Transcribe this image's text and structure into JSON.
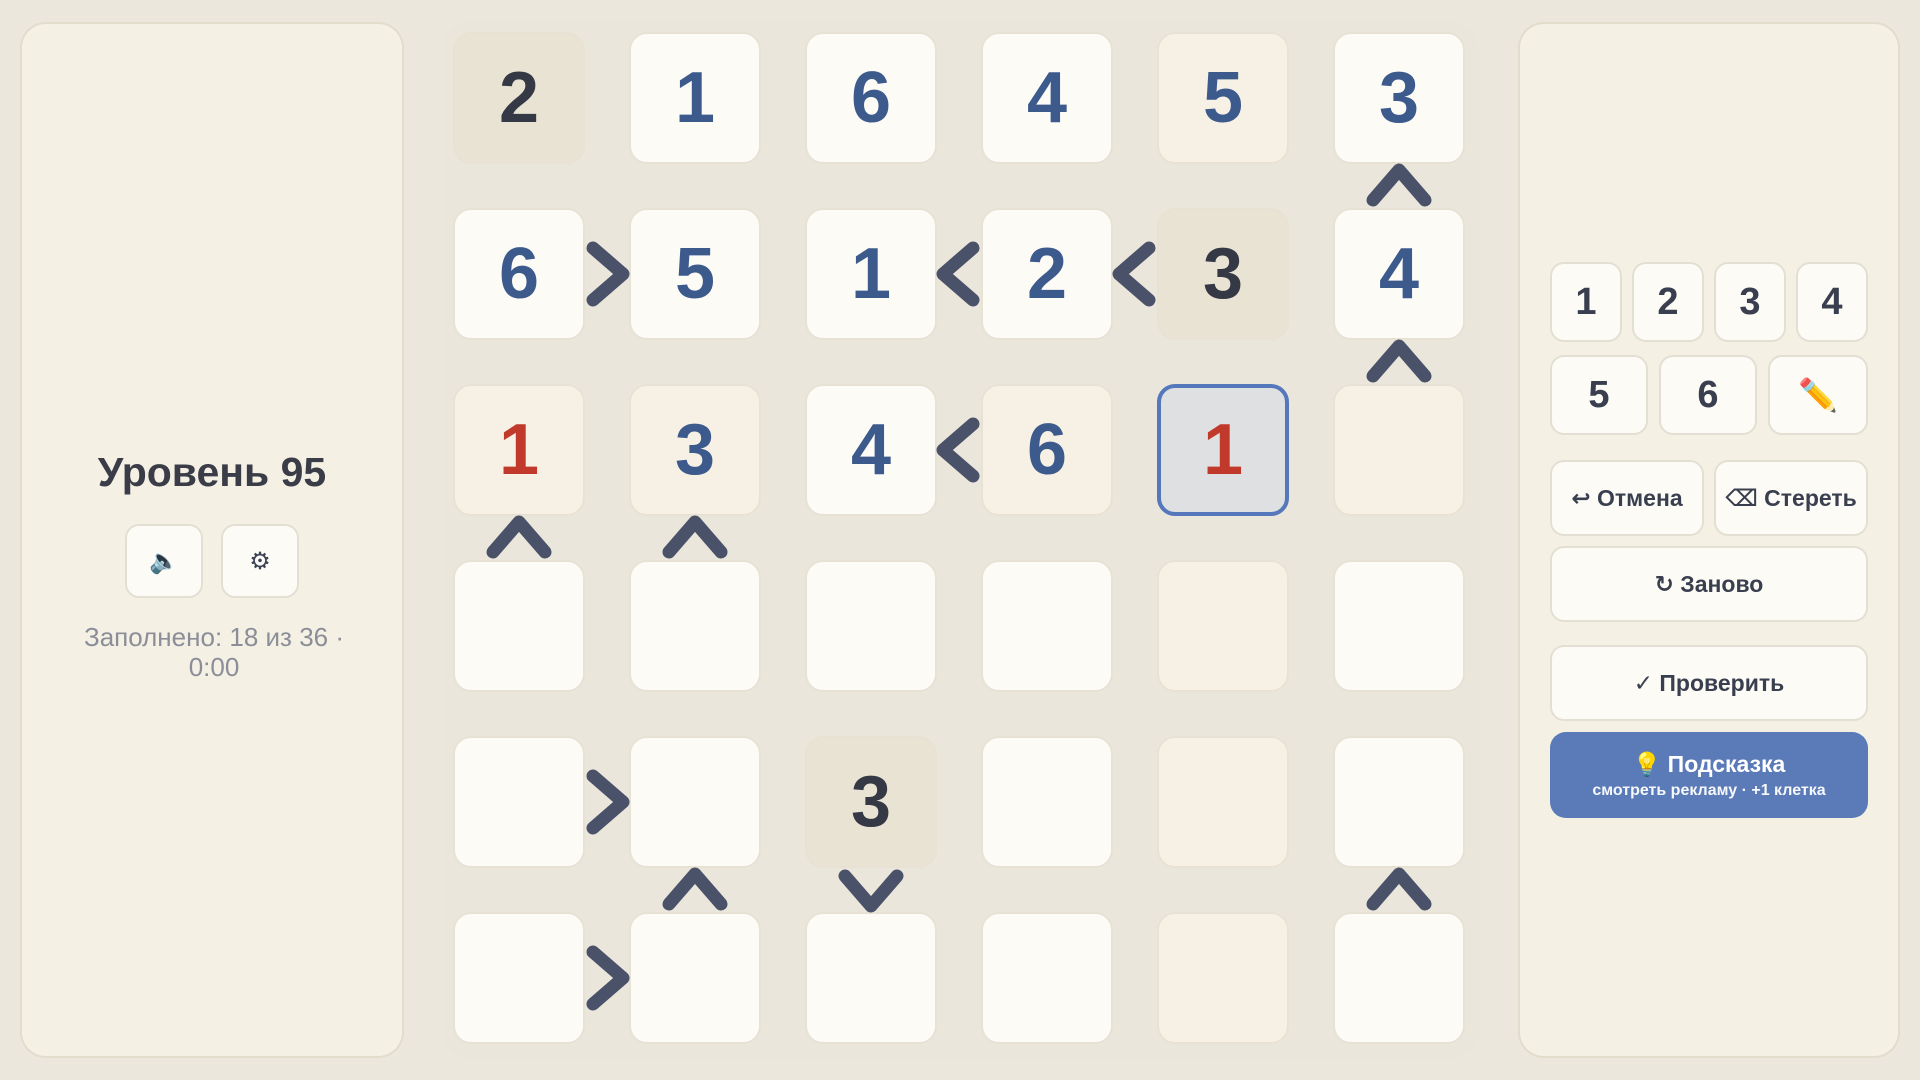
{
  "left": {
    "level_title": "Уровень 95",
    "sound_icon": "🔈",
    "settings_icon": "⚙",
    "status": "Заполнено: 18 из 36 · 0:00"
  },
  "board": {
    "size": 6,
    "rows": [
      [
        "2",
        "1",
        "6",
        "4",
        "5",
        "3"
      ],
      [
        "6",
        "5",
        "1",
        "2",
        "3",
        "4"
      ],
      [
        "1",
        "3",
        "4",
        "6",
        "1",
        ""
      ],
      [
        "",
        "",
        "",
        "",
        "",
        ""
      ],
      [
        "",
        "",
        "3",
        "",
        "",
        ""
      ],
      [
        "",
        "",
        "",
        "",
        "",
        ""
      ]
    ],
    "given": [
      [
        0,
        0
      ],
      [
        1,
        4
      ],
      [
        4,
        2
      ]
    ],
    "errors": [
      [
        2,
        0
      ],
      [
        2,
        4
      ]
    ],
    "selected": [
      2,
      4
    ],
    "shaded": [
      [
        0,
        4
      ],
      [
        2,
        0
      ],
      [
        2,
        1
      ],
      [
        2,
        3
      ],
      [
        2,
        5
      ],
      [
        3,
        4
      ],
      [
        4,
        4
      ],
      [
        5,
        4
      ]
    ],
    "constraints": [
      {
        "type": "h",
        "r": 1,
        "c": 0,
        "sign": ">"
      },
      {
        "type": "h",
        "r": 1,
        "c": 2,
        "sign": "<"
      },
      {
        "type": "h",
        "r": 1,
        "c": 3,
        "sign": "<"
      },
      {
        "type": "h",
        "r": 2,
        "c": 2,
        "sign": "<"
      },
      {
        "type": "h",
        "r": 4,
        "c": 0,
        "sign": ">"
      },
      {
        "type": "h",
        "r": 5,
        "c": 0,
        "sign": ">"
      },
      {
        "type": "v",
        "r": 0,
        "c": 5,
        "sign": "^"
      },
      {
        "type": "v",
        "r": 1,
        "c": 5,
        "sign": "^"
      },
      {
        "type": "v",
        "r": 2,
        "c": 0,
        "sign": "^"
      },
      {
        "type": "v",
        "r": 2,
        "c": 1,
        "sign": "^"
      },
      {
        "type": "v",
        "r": 4,
        "c": 1,
        "sign": "^"
      },
      {
        "type": "v",
        "r": 4,
        "c": 2,
        "sign": "v"
      },
      {
        "type": "v",
        "r": 4,
        "c": 5,
        "sign": "^"
      }
    ]
  },
  "right": {
    "numbers": [
      "1",
      "2",
      "3",
      "4",
      "5",
      "6"
    ],
    "pencil_icon": "✏️",
    "undo_label": "↩ Отмена",
    "erase_label": "⌫ Стереть",
    "restart_label": "↻ Заново",
    "check_label": "✓ Проверить",
    "hint_title": "💡  Подсказка",
    "hint_subtitle": "смотреть рекламу · +1 клетка"
  },
  "colors": {
    "accent": "#5a7ab8",
    "error": "#c0392b",
    "entry": "#3d5a8c",
    "given": "#353845",
    "sign": "#4a5269"
  }
}
